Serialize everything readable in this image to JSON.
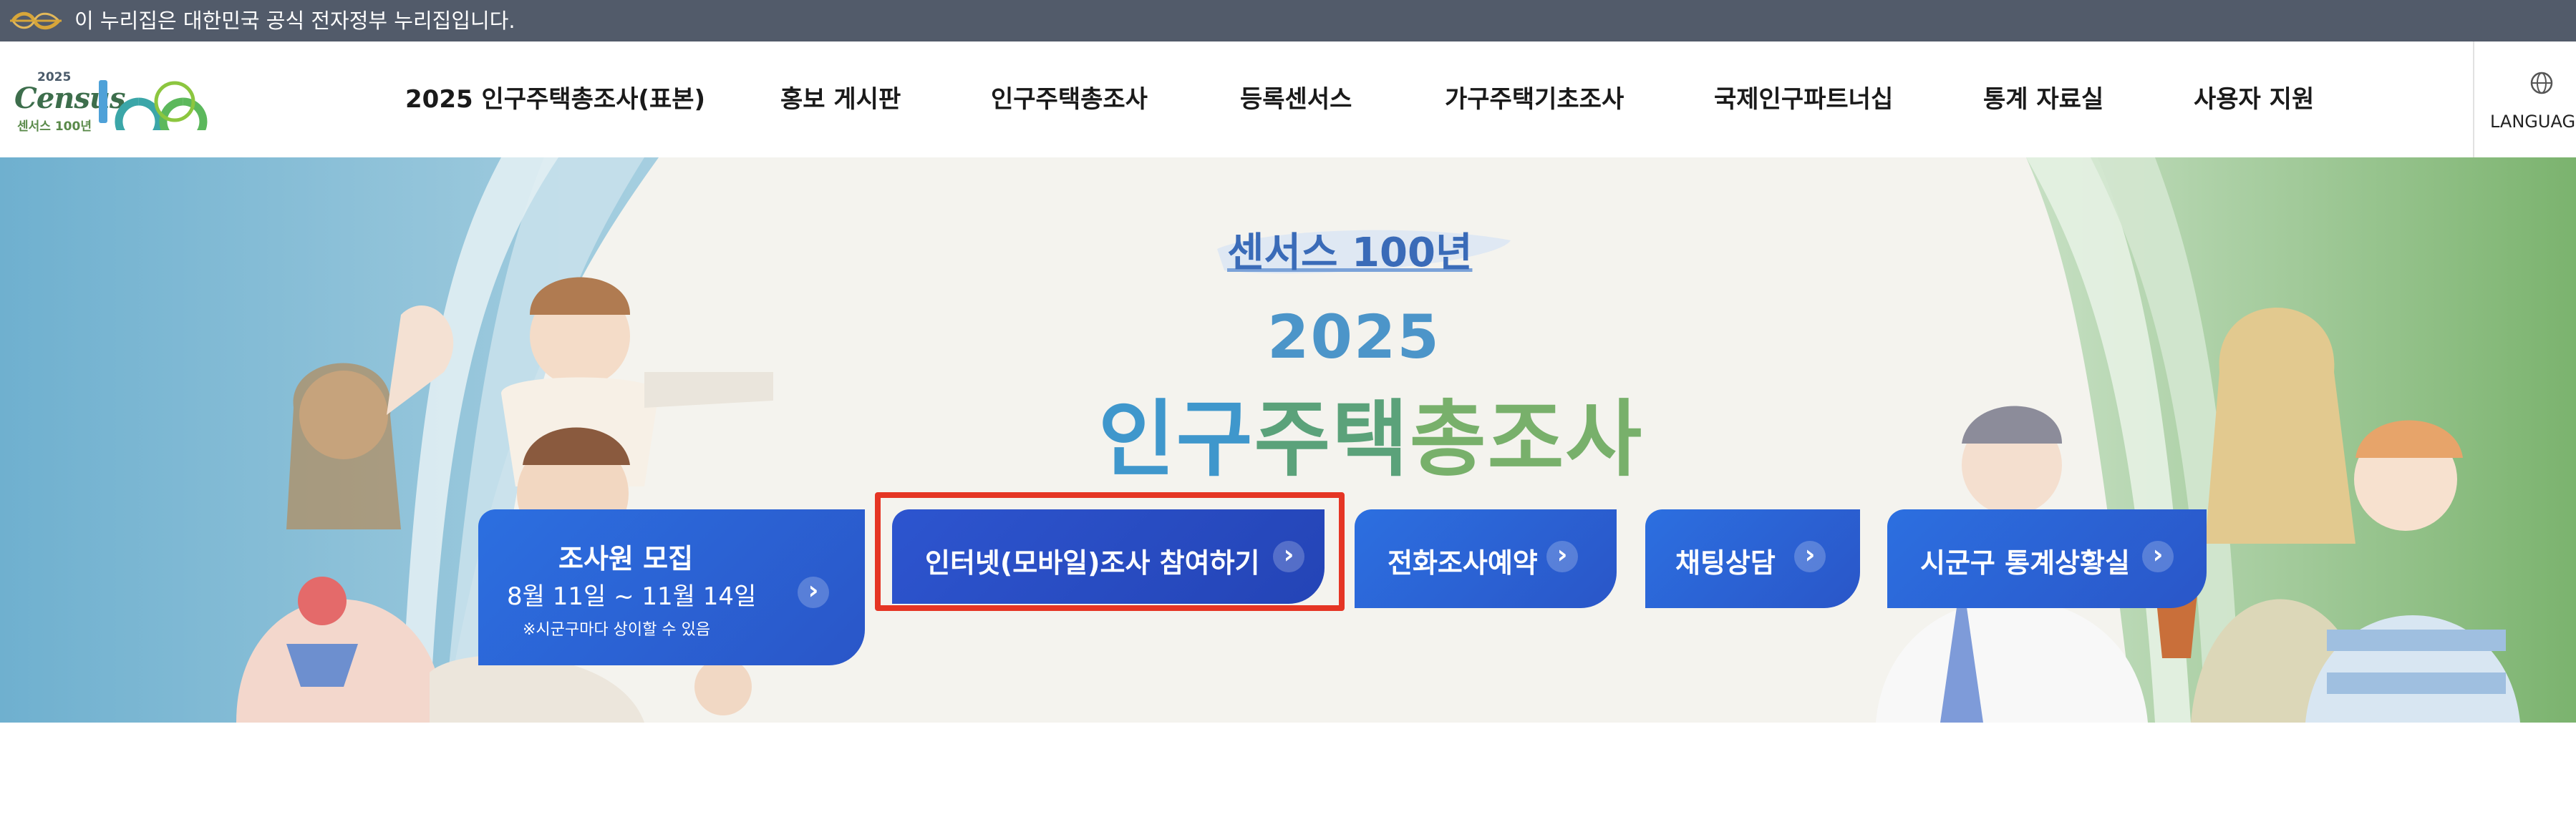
{
  "gov_banner": {
    "text": "이 누리집은 대한민국 공식 전자정부 누리집입니다."
  },
  "header": {
    "logo": {
      "year": "2025",
      "census": "Census",
      "subtitle": "센서스 100년",
      "number": "100"
    },
    "nav": [
      "2025 인구주택총조사(표본)",
      "홍보 게시판",
      "인구주택총조사",
      "등록센서스",
      "가구주택기초조사",
      "국제인구파트너십",
      "통계 자료실",
      "사용자 지원"
    ],
    "language_label": "LANGUAG"
  },
  "hero": {
    "badge": "센서스 100년",
    "year": "2025",
    "title_part1": "인구",
    "title_part2": "주택",
    "title_part3": "총조사",
    "buttons": {
      "recruit": {
        "label": "조사원 모집",
        "dates": "8월 11일 ~ 11월 14일",
        "note": "※시군구마다 상이할 수 있음"
      },
      "internet": {
        "label": "인터넷(모바일)조사 참여하기"
      },
      "phone": {
        "label": "전화조사예약"
      },
      "chat": {
        "label": "채팅상담"
      },
      "district": {
        "label": "시군구 통계상황실"
      }
    }
  },
  "colors": {
    "gov_banner_bg": "#525b6a",
    "button_blue": "#2c6fe0",
    "highlight_red": "#e53524",
    "title_blue": "#3f97cc",
    "title_green": "#5ba27a"
  },
  "icons": [
    "egov-logo-icon",
    "globe-icon",
    "chevron-right-icon"
  ]
}
